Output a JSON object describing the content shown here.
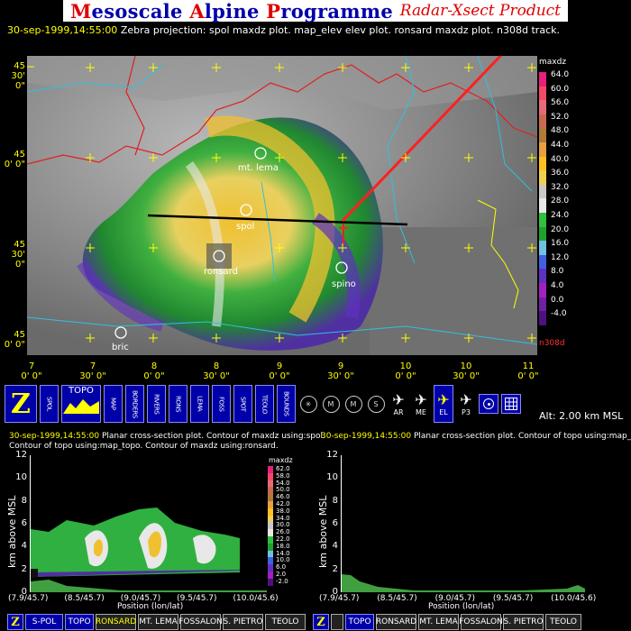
{
  "header": {
    "title_m": "M",
    "title_rest1": "esoscale ",
    "title_a": "A",
    "title_rest2": "lpine ",
    "title_p": "P",
    "title_rest3": "rogramme",
    "subtitle": "Radar-Xsect Product"
  },
  "status": {
    "timestamp": "30-sep-1999,14:55:00",
    "text": "Zebra projection: spol maxdz plot. map_elev elev plot. ronsard maxdz plot. n308d track."
  },
  "map": {
    "lat_labels": [
      {
        "deg": "45",
        "min": "30' 0\""
      },
      {
        "deg": "45",
        "min": "0' 0\""
      },
      {
        "deg": "45",
        "min": "30' 0\""
      },
      {
        "deg": "45",
        "min": "0' 0\""
      }
    ],
    "lon_labels": [
      {
        "deg": "7",
        "min": "0' 0\""
      },
      {
        "deg": "7",
        "min": "30' 0\""
      },
      {
        "deg": "8",
        "min": "0' 0\""
      },
      {
        "deg": "8",
        "min": "30' 0\""
      },
      {
        "deg": "9",
        "min": "0' 0\""
      },
      {
        "deg": "9",
        "min": "30' 0\""
      },
      {
        "deg": "10",
        "min": "0' 0\""
      },
      {
        "deg": "10",
        "min": "30' 0\""
      },
      {
        "deg": "11",
        "min": "0' 0\""
      }
    ],
    "sites": [
      "mt. lema",
      "spol",
      "ronsard",
      "spino",
      "bric"
    ],
    "track_label": "n308d",
    "colors": {
      "track": "#ff2020",
      "border": "#e02020",
      "lakes": "#30c0e0",
      "xsect_line": "#000000"
    }
  },
  "colorbar": {
    "title": "maxdz",
    "labels": [
      "64.0",
      "60.0",
      "56.0",
      "52.0",
      "48.0",
      "44.0",
      "40.0",
      "36.0",
      "32.0",
      "28.0",
      "24.0",
      "20.0",
      "16.0",
      "12.0",
      "8.0",
      "4.0",
      "0.0",
      "-4.0"
    ],
    "colors": [
      "#e8207a",
      "#f04a66",
      "#e86a7a",
      "#c86a50",
      "#b07a3a",
      "#e8a040",
      "#ffc020",
      "#f0d050",
      "#c8c8c8",
      "#e8e8e8",
      "#30c040",
      "#20a030",
      "#70c0e0",
      "#4060e0",
      "#6030c0",
      "#a020c0",
      "#7020a0",
      "#501080"
    ]
  },
  "toolbar": {
    "z_label": "Z",
    "buttons": [
      "SPOL",
      "TOPO",
      "MAP",
      "BORDERS",
      "RIVERS",
      "RONS",
      "LEMA",
      "FOSS",
      "SPOT",
      "TEOLO",
      "BOUNDS"
    ],
    "round_buttons": [
      "",
      "M",
      "M",
      "S"
    ],
    "planes": [
      "AR",
      "ME",
      "EL",
      "P3"
    ],
    "altitude": "Alt: 2.00 km MSL"
  },
  "xsect_left": {
    "timestamp": "30-sep-1999,14:55:00",
    "caption1": " Planar cross-section plot.  Contour of maxdz using:spol.",
    "caption2": "Contour of topo using:map_topo.  Contour of maxdz using:ronsard.",
    "ylabel": "km above MSL",
    "xlabel": "Position (lon/lat)",
    "yticks": [
      "12",
      "10",
      "8",
      "6",
      "4",
      "2",
      "0"
    ],
    "xticks": [
      "(7.9/45.7)",
      "(8.5/45.7)",
      "(9.0/45.7)",
      "(9.5/45.7)",
      "(10.0/45.6)"
    ],
    "cb_title": "maxdz",
    "cb_labels": [
      "62.0",
      "58.0",
      "54.0",
      "50.0",
      "46.0",
      "42.0",
      "38.0",
      "34.0",
      "30.0",
      "26.0",
      "22.0",
      "18.0",
      "14.0",
      "10.0",
      "6.0",
      "2.0",
      "-2.0"
    ]
  },
  "xsect_right": {
    "timestamp": "30-sep-1999,14:55:00",
    "caption1": " Planar cross-section plot.  Contour of topo using:map_topo.",
    "ylabel": "km above MSL",
    "xlabel": "Position (lon/lat)",
    "yticks": [
      "12",
      "10",
      "8",
      "6",
      "4",
      "2",
      "0"
    ],
    "xticks": [
      "(7.9/45.7)",
      "(8.5/45.7)",
      "(9.0/45.7)",
      "(9.5/45.7)",
      "(10.0/45.6)"
    ]
  },
  "bottom_left": [
    "S-POL",
    "TOPO",
    "RONSARD",
    "MT. LEMA",
    "FOSSALON",
    "S. PIETRO",
    "TEOLO"
  ],
  "bottom_right": [
    "TOPO",
    "RONSARD",
    "MT. LEMA",
    "FOSSALON",
    "S. PIETRO",
    "TEOLO"
  ],
  "bottom_z": "Z"
}
